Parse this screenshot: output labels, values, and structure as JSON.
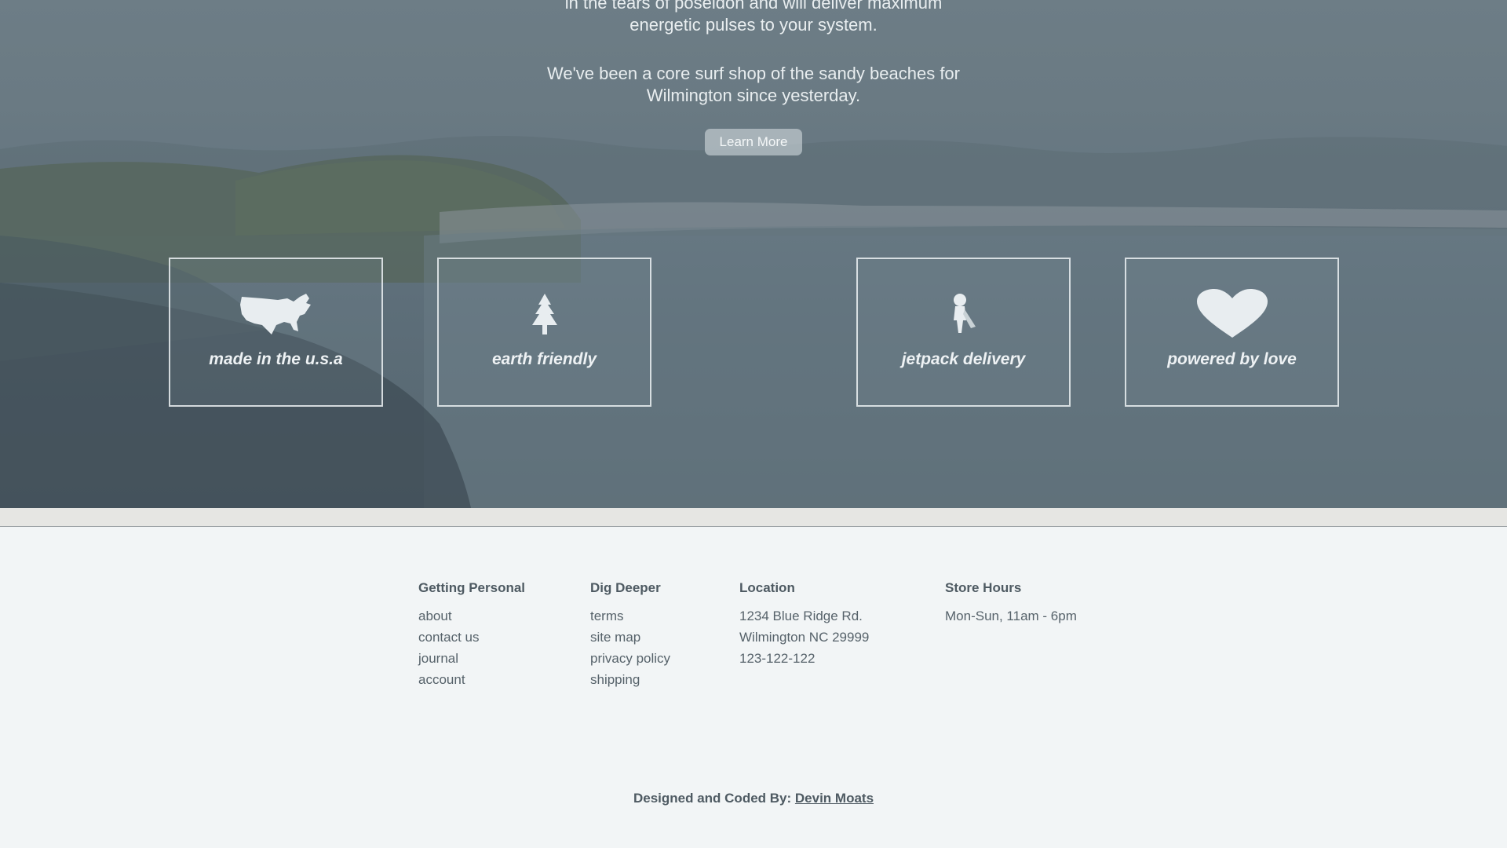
{
  "hero": {
    "text_line_1": "in the tears of poseidon and will deliver maximum",
    "text_line_2": "energetic pulses to your system.",
    "text_line_3": "We've been a core surf shop of the sandy beaches for",
    "text_line_4": "Wilmington since yesterday.",
    "learn_more_label": "Learn More"
  },
  "features": [
    {
      "label": "made in the u.s.a",
      "icon": "usa-map-icon"
    },
    {
      "label": "earth friendly",
      "icon": "tree-icon"
    },
    {
      "label": "jetpack delivery",
      "icon": "jetpack-icon"
    },
    {
      "label": "powered by love",
      "icon": "heart-icon"
    }
  ],
  "footer": {
    "columns": [
      {
        "title": "Getting Personal",
        "items": [
          "about",
          "contact us",
          "journal",
          "account"
        ]
      },
      {
        "title": "Dig Deeper",
        "items": [
          "terms",
          "site map",
          "privacy policy",
          "shipping"
        ]
      },
      {
        "title": "Location",
        "items": [
          "1234 Blue Ridge Rd.",
          "Wilmington NC 29999",
          "123-122-122"
        ]
      },
      {
        "title": "Store Hours",
        "items": [
          "Mon-Sun, 11am - 6pm"
        ]
      }
    ],
    "credit_prefix": "Designed and Coded By:",
    "credit_name": "Devin Moats"
  },
  "colors": {
    "hero_overlay": "#66767f",
    "footer_bg": "#f2f5f6",
    "divider": "#e6e6e3",
    "text_dark": "#4e5a62"
  }
}
